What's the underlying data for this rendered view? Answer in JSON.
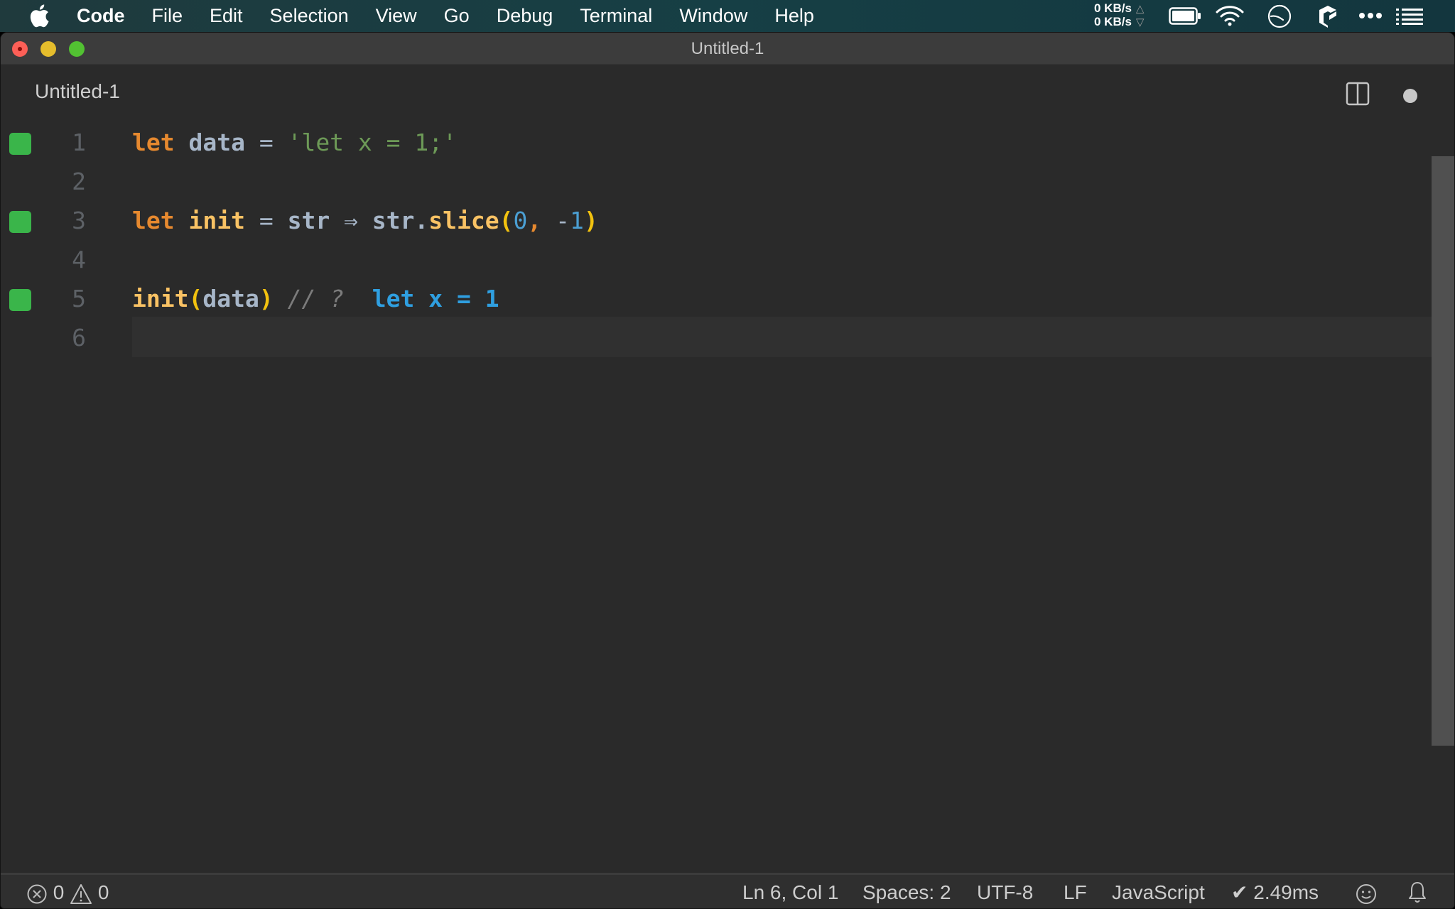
{
  "menubar": {
    "apple_icon": "apple-logo-icon",
    "items": [
      "Code",
      "File",
      "Edit",
      "Selection",
      "View",
      "Go",
      "Debug",
      "Terminal",
      "Window",
      "Help"
    ],
    "netspeed": {
      "up": "0 KB/s",
      "down": "0 KB/s",
      "up_arrow": "△",
      "down_arrow": "▽"
    },
    "tray_icons": [
      "battery-icon",
      "wifi-icon",
      "clock-icon",
      "box-app-icon",
      "more-dots-icon",
      "list-menu-icon"
    ]
  },
  "window": {
    "title": "Untitled-1",
    "traffic_lights": [
      "close",
      "minimize",
      "maximize"
    ]
  },
  "tabbar": {
    "tab_label": "Untitled-1",
    "split_editor_icon": "split-editor-icon",
    "unsaved_indicator_icon": "unsaved-dot-icon"
  },
  "editor": {
    "current_line": 6,
    "lines": [
      {
        "number": "1",
        "marker": true,
        "tokens": [
          {
            "t": "let",
            "c": "kw"
          },
          {
            "t": " ",
            "c": "op"
          },
          {
            "t": "data",
            "c": "var"
          },
          {
            "t": " = ",
            "c": "op"
          },
          {
            "t": "'let x = 1;'",
            "c": "str"
          }
        ]
      },
      {
        "number": "2",
        "marker": false,
        "tokens": []
      },
      {
        "number": "3",
        "marker": true,
        "tokens": [
          {
            "t": "let",
            "c": "kw"
          },
          {
            "t": " ",
            "c": "op"
          },
          {
            "t": "init",
            "c": "fn"
          },
          {
            "t": " = ",
            "c": "op"
          },
          {
            "t": "str",
            "c": "var"
          },
          {
            "t": " ⇒ ",
            "c": "op"
          },
          {
            "t": "str.",
            "c": "var"
          },
          {
            "t": "slice",
            "c": "fn"
          },
          {
            "t": "(",
            "c": "paren"
          },
          {
            "t": "0",
            "c": "num"
          },
          {
            "t": ", ",
            "c": "kw"
          },
          {
            "t": "-",
            "c": "op"
          },
          {
            "t": "1",
            "c": "num"
          },
          {
            "t": ")",
            "c": "paren"
          }
        ]
      },
      {
        "number": "4",
        "marker": false,
        "tokens": []
      },
      {
        "number": "5",
        "marker": true,
        "tokens": [
          {
            "t": "init",
            "c": "fn"
          },
          {
            "t": "(",
            "c": "paren"
          },
          {
            "t": "data",
            "c": "var"
          },
          {
            "t": ")",
            "c": "paren"
          },
          {
            "t": " // ? ",
            "c": "comment"
          },
          {
            "t": " let x = 1",
            "c": "result"
          }
        ]
      },
      {
        "number": "6",
        "marker": false,
        "tokens": []
      }
    ]
  },
  "statusbar": {
    "errors": "0",
    "warnings": "0",
    "cursor_position": "Ln 6, Col 1",
    "indentation": "Spaces: 2",
    "encoding": "UTF-8",
    "eol": "LF",
    "language": "JavaScript",
    "timing": "✔ 2.49ms",
    "feedback_icon": "smiley-icon",
    "notifications_icon": "bell-icon"
  }
}
